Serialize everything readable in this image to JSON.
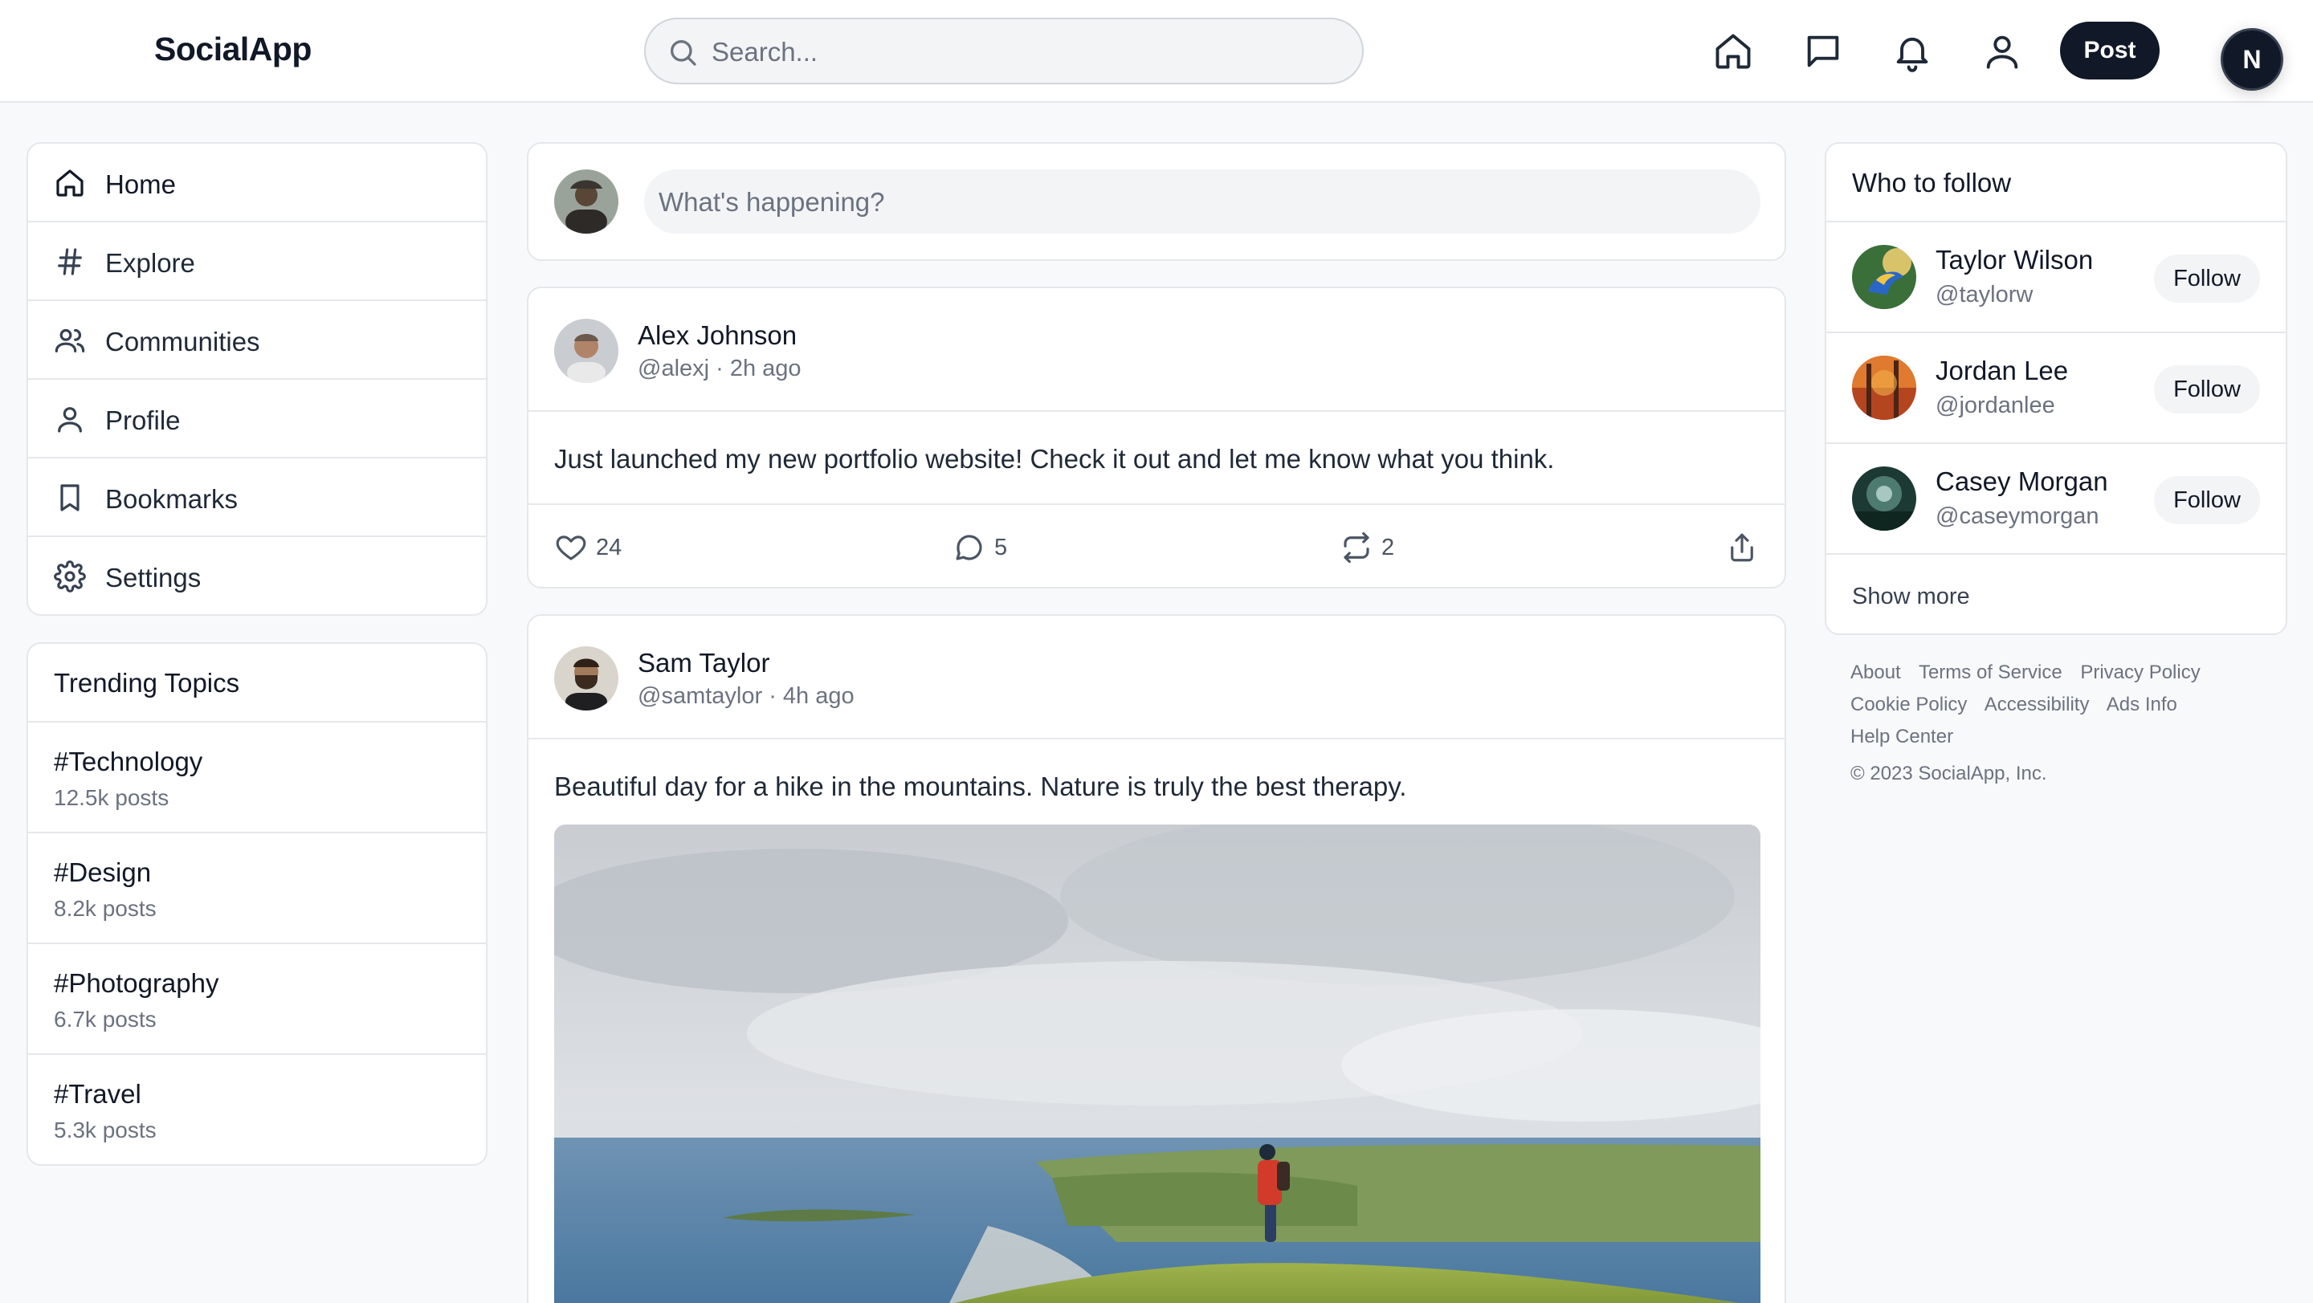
{
  "header": {
    "logo": "SocialApp",
    "search_placeholder": "Search...",
    "nav_icons": [
      "home-icon",
      "message-icon",
      "bell-icon",
      "user-icon"
    ],
    "post_label": "Post",
    "user_initial": "N"
  },
  "sidebar": {
    "items": [
      {
        "label": "Home",
        "icon": "home-icon"
      },
      {
        "label": "Explore",
        "icon": "hash-icon"
      },
      {
        "label": "Communities",
        "icon": "users-icon"
      },
      {
        "label": "Profile",
        "icon": "user-icon"
      },
      {
        "label": "Bookmarks",
        "icon": "bookmark-icon"
      },
      {
        "label": "Settings",
        "icon": "gear-icon"
      }
    ]
  },
  "trending": {
    "title": "Trending Topics",
    "topics": [
      {
        "tag": "#Technology",
        "count": "12.5k posts"
      },
      {
        "tag": "#Design",
        "count": "8.2k posts"
      },
      {
        "tag": "#Photography",
        "count": "6.7k posts"
      },
      {
        "tag": "#Travel",
        "count": "5.3k posts"
      }
    ]
  },
  "compose": {
    "placeholder": "What's happening?"
  },
  "posts": [
    {
      "name": "Alex Johnson",
      "meta": "@alexj · 2h ago",
      "text": "Just launched my new portfolio website! Check it out and let me know what you think.",
      "likes": "24",
      "comments": "5",
      "reposts": "2"
    },
    {
      "name": "Sam Taylor",
      "meta": "@samtaylor · 4h ago",
      "text": "Beautiful day for a hike in the mountains. Nature is truly the best therapy."
    }
  ],
  "who_to_follow": {
    "title": "Who to follow",
    "users": [
      {
        "name": "Taylor Wilson",
        "handle": "@taylorw",
        "button": "Follow"
      },
      {
        "name": "Jordan Lee",
        "handle": "@jordanlee",
        "button": "Follow"
      },
      {
        "name": "Casey Morgan",
        "handle": "@caseymorgan",
        "button": "Follow"
      }
    ],
    "show_more": "Show more"
  },
  "footer": {
    "links": [
      "About",
      "Terms of Service",
      "Privacy Policy",
      "Cookie Policy",
      "Accessibility",
      "Ads Info",
      "Help Center"
    ],
    "copyright": "© 2023 SocialApp, Inc."
  },
  "colors": {
    "accent": "#111827",
    "background": "#f8f9fb",
    "border": "#e5e7eb",
    "muted_text": "#6b7280"
  }
}
